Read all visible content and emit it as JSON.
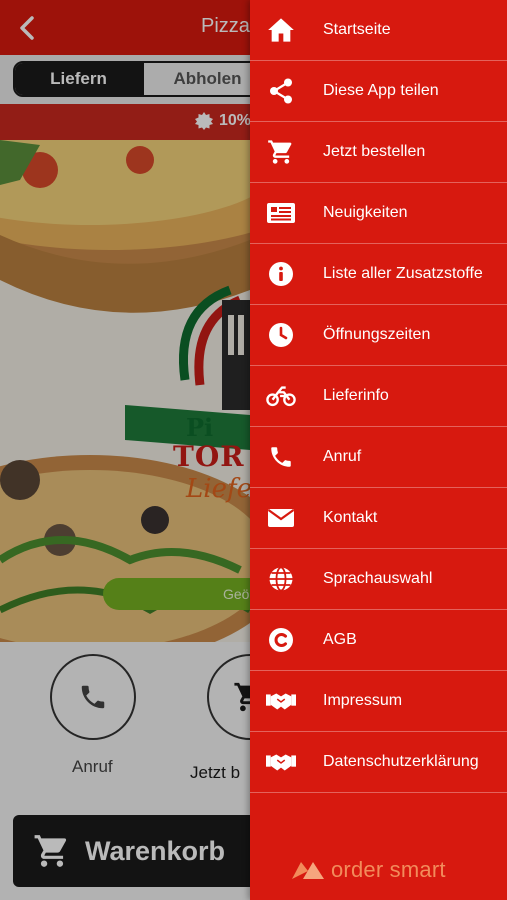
{
  "header": {
    "title": "Pizza"
  },
  "order_mode": {
    "delivery_label": "Liefern",
    "pickup_label": "Abholen",
    "selected": "Liefern"
  },
  "banner": {
    "discount_text": "10%"
  },
  "hero": {
    "logo_line1": "Pi",
    "logo_line2": "TOR",
    "logo_line3": "Liefer",
    "status_pill": "Geö"
  },
  "actions": {
    "call_label": "Anruf",
    "order_label": "Jetzt b"
  },
  "cart": {
    "label": "Warenkorb"
  },
  "drawer": {
    "items": [
      {
        "label": "Startseite",
        "icon": "home-icon"
      },
      {
        "label": "Diese App teilen",
        "icon": "share-icon"
      },
      {
        "label": "Jetzt bestellen",
        "icon": "cart-icon"
      },
      {
        "label": "Neuigkeiten",
        "icon": "news-icon"
      },
      {
        "label": "Liste aller Zusatzstoffe",
        "icon": "info-icon"
      },
      {
        "label": "Öffnungszeiten",
        "icon": "clock-icon"
      },
      {
        "label": "Lieferinfo",
        "icon": "motorcycle-icon"
      },
      {
        "label": "Anruf",
        "icon": "phone-icon"
      },
      {
        "label": "Kontakt",
        "icon": "mail-icon"
      },
      {
        "label": "Sprachauswahl",
        "icon": "globe-icon"
      },
      {
        "label": "AGB",
        "icon": "copyright-icon"
      },
      {
        "label": "Impressum",
        "icon": "handshake-icon"
      },
      {
        "label": "Datenschutzerklärung",
        "icon": "handshake-icon"
      }
    ],
    "brand": "order smart"
  },
  "colors": {
    "primary": "#d7190f",
    "dark": "#1b1b1b",
    "brand": "#f28b5b",
    "pill": "#75b021"
  }
}
